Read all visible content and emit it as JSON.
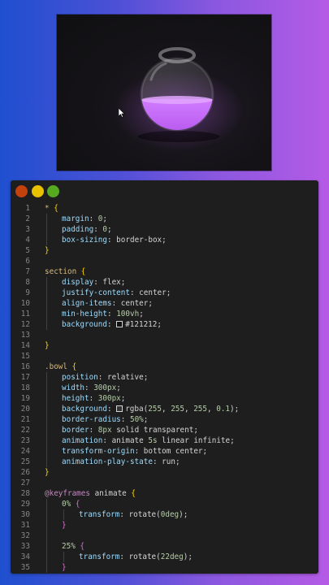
{
  "preview": {
    "cursor_icon": "cursor-arrow-icon",
    "liquid_color": "#bf5ff0",
    "background_color": "#121212"
  },
  "window_controls": [
    {
      "name": "close",
      "color": "#c2410c"
    },
    {
      "name": "minimize",
      "color": "#e8c200"
    },
    {
      "name": "maximize",
      "color": "#56a81e"
    }
  ],
  "code_lines": [
    {
      "n": "1",
      "tokens": [
        [
          "sel",
          "* "
        ],
        [
          "br",
          "{"
        ]
      ]
    },
    {
      "n": "2",
      "indent": 1,
      "tokens": [
        [
          "prop",
          "margin"
        ],
        [
          "plain",
          ": "
        ],
        [
          "num",
          "0"
        ],
        [
          "plain",
          ";"
        ]
      ]
    },
    {
      "n": "3",
      "indent": 1,
      "tokens": [
        [
          "prop",
          "padding"
        ],
        [
          "plain",
          ": "
        ],
        [
          "num",
          "0"
        ],
        [
          "plain",
          ";"
        ]
      ]
    },
    {
      "n": "4",
      "indent": 1,
      "tokens": [
        [
          "prop",
          "box-sizing"
        ],
        [
          "plain",
          ": border-box;"
        ]
      ]
    },
    {
      "n": "5",
      "tokens": [
        [
          "br",
          "}"
        ]
      ]
    },
    {
      "n": "6",
      "tokens": []
    },
    {
      "n": "7",
      "tokens": [
        [
          "sel",
          "section "
        ],
        [
          "br",
          "{"
        ]
      ]
    },
    {
      "n": "8",
      "indent": 1,
      "tokens": [
        [
          "prop",
          "display"
        ],
        [
          "plain",
          ": flex;"
        ]
      ]
    },
    {
      "n": "9",
      "indent": 1,
      "tokens": [
        [
          "prop",
          "justify-content"
        ],
        [
          "plain",
          ": center;"
        ]
      ]
    },
    {
      "n": "10",
      "indent": 1,
      "tokens": [
        [
          "prop",
          "align-items"
        ],
        [
          "plain",
          ": center;"
        ]
      ]
    },
    {
      "n": "11",
      "indent": 1,
      "tokens": [
        [
          "prop",
          "min-height"
        ],
        [
          "plain",
          ": "
        ],
        [
          "num",
          "100vh"
        ],
        [
          "plain",
          ";"
        ]
      ]
    },
    {
      "n": "12",
      "indent": 1,
      "tokens": [
        [
          "prop",
          "background"
        ],
        [
          "plain",
          ": "
        ],
        [
          "swatch",
          "#121212"
        ],
        [
          "plain",
          "#121212;"
        ]
      ]
    },
    {
      "n": "13",
      "tokens": []
    },
    {
      "n": "14",
      "tokens": [
        [
          "br",
          "}"
        ]
      ]
    },
    {
      "n": "15",
      "tokens": []
    },
    {
      "n": "16",
      "tokens": [
        [
          "sel",
          ".bowl "
        ],
        [
          "br",
          "{"
        ]
      ]
    },
    {
      "n": "17",
      "indent": 1,
      "tokens": [
        [
          "prop",
          "position"
        ],
        [
          "plain",
          ": relative;"
        ]
      ]
    },
    {
      "n": "18",
      "indent": 1,
      "tokens": [
        [
          "prop",
          "width"
        ],
        [
          "plain",
          ": "
        ],
        [
          "num",
          "300px"
        ],
        [
          "plain",
          ";"
        ]
      ]
    },
    {
      "n": "19",
      "indent": 1,
      "tokens": [
        [
          "prop",
          "height"
        ],
        [
          "plain",
          ": "
        ],
        [
          "num",
          "300px"
        ],
        [
          "plain",
          ";"
        ]
      ]
    },
    {
      "n": "20",
      "indent": 1,
      "tokens": [
        [
          "prop",
          "background"
        ],
        [
          "plain",
          ": "
        ],
        [
          "swatch",
          "rgba(255,255,255,0.1)"
        ],
        [
          "plain",
          "rgba("
        ],
        [
          "num",
          "255"
        ],
        [
          "plain",
          ", "
        ],
        [
          "num",
          "255"
        ],
        [
          "plain",
          ", "
        ],
        [
          "num",
          "255"
        ],
        [
          "plain",
          ", "
        ],
        [
          "num",
          "0.1"
        ],
        [
          "plain",
          ");"
        ]
      ]
    },
    {
      "n": "21",
      "indent": 1,
      "tokens": [
        [
          "prop",
          "border-radius"
        ],
        [
          "plain",
          ": "
        ],
        [
          "num",
          "50%"
        ],
        [
          "plain",
          ";"
        ]
      ]
    },
    {
      "n": "22",
      "indent": 1,
      "tokens": [
        [
          "prop",
          "border"
        ],
        [
          "plain",
          ": "
        ],
        [
          "num",
          "8px"
        ],
        [
          "plain",
          " solid transparent;"
        ]
      ]
    },
    {
      "n": "23",
      "indent": 1,
      "tokens": [
        [
          "prop",
          "animation"
        ],
        [
          "plain",
          ": animate "
        ],
        [
          "num",
          "5s"
        ],
        [
          "plain",
          " linear infinite;"
        ]
      ]
    },
    {
      "n": "24",
      "indent": 1,
      "tokens": [
        [
          "prop",
          "transform-origin"
        ],
        [
          "plain",
          ": bottom center;"
        ]
      ]
    },
    {
      "n": "25",
      "indent": 1,
      "tokens": [
        [
          "prop",
          "animation-play-state"
        ],
        [
          "plain",
          ": run;"
        ]
      ]
    },
    {
      "n": "26",
      "tokens": [
        [
          "br",
          "}"
        ]
      ]
    },
    {
      "n": "27",
      "tokens": []
    },
    {
      "n": "28",
      "tokens": [
        [
          "kw",
          "@keyframes"
        ],
        [
          "plain",
          " animate "
        ],
        [
          "br",
          "{"
        ]
      ]
    },
    {
      "n": "29",
      "indent": 1,
      "tokens": [
        [
          "num",
          "0%"
        ],
        [
          "plain",
          " "
        ],
        [
          "br2",
          "{"
        ]
      ]
    },
    {
      "n": "30",
      "indent": 2,
      "tokens": [
        [
          "prop",
          "transform"
        ],
        [
          "plain",
          ": rotate("
        ],
        [
          "num",
          "0deg"
        ],
        [
          "plain",
          ");"
        ]
      ]
    },
    {
      "n": "31",
      "indent": 1,
      "tokens": [
        [
          "br2",
          "}"
        ]
      ]
    },
    {
      "n": "32",
      "indent": 1,
      "tokens": []
    },
    {
      "n": "33",
      "indent": 1,
      "tokens": [
        [
          "num",
          "25%"
        ],
        [
          "plain",
          " "
        ],
        [
          "br2",
          "{"
        ]
      ]
    },
    {
      "n": "34",
      "indent": 2,
      "tokens": [
        [
          "prop",
          "transform"
        ],
        [
          "plain",
          ": rotate("
        ],
        [
          "num",
          "22deg"
        ],
        [
          "plain",
          ");"
        ]
      ]
    },
    {
      "n": "35",
      "indent": 1,
      "tokens": [
        [
          "br2",
          "}"
        ]
      ]
    }
  ]
}
